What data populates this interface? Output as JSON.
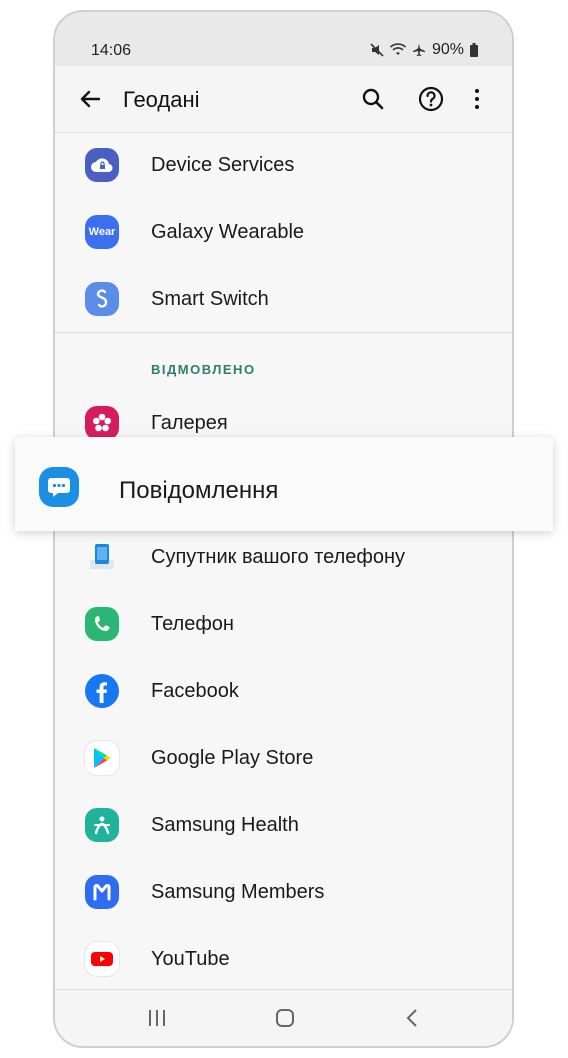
{
  "status_bar": {
    "time": "14:06",
    "battery": "90%"
  },
  "app_bar": {
    "title": "Геодані"
  },
  "allowed_apps": [
    {
      "label": "Device Services",
      "icon": "cloud-lock-icon",
      "color": "#4a5fc1"
    },
    {
      "label": "Galaxy Wearable",
      "icon": "wear-icon",
      "color": "#3b6ff0",
      "text": "Wear"
    },
    {
      "label": "Smart Switch",
      "icon": "smart-switch-icon",
      "color": "#5b8de8"
    }
  ],
  "section_denied": "ВІДМОВЛЕНО",
  "denied_apps": [
    {
      "label": "Галерея",
      "icon": "gallery-flower-icon",
      "color": "#d61d5b"
    },
    {
      "label": "Супутник вашого телефону",
      "icon": "your-phone-icon",
      "color": "#1e88d8"
    },
    {
      "label": "Телефон",
      "icon": "phone-icon",
      "color": "#2bb673"
    },
    {
      "label": "Facebook",
      "icon": "facebook-icon",
      "color": "#1877f2"
    },
    {
      "label": "Google Play Store",
      "icon": "play-store-icon",
      "color": "#ffffff"
    },
    {
      "label": "Samsung Health",
      "icon": "samsung-health-icon",
      "color": "#20b39a"
    },
    {
      "label": "Samsung Members",
      "icon": "samsung-members-icon",
      "color": "#2f6cf0"
    },
    {
      "label": "YouTube",
      "icon": "youtube-icon",
      "color": "#ff0000"
    }
  ],
  "highlighted_app": {
    "label": "Повідомлення",
    "icon": "messages-icon",
    "color": "#1a8fe3"
  }
}
